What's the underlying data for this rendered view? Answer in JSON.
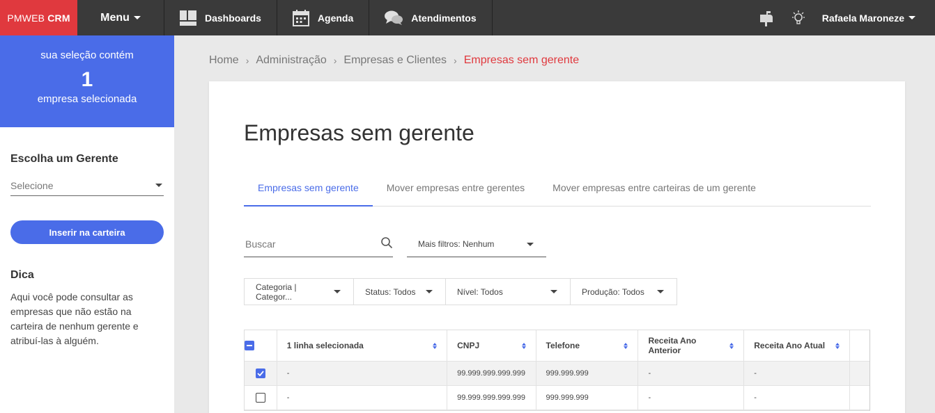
{
  "brand": {
    "name": "PMWEB",
    "product": "CRM"
  },
  "topnav": {
    "menu_label": "Menu",
    "items": [
      {
        "label": "Dashboards",
        "icon": "dashboard-icon"
      },
      {
        "label": "Agenda",
        "icon": "calendar-icon"
      },
      {
        "label": "Atendimentos",
        "icon": "chat-icon"
      }
    ],
    "user_name": "Rafaela Maroneze"
  },
  "sidebar": {
    "selection_line1": "sua seleção contém",
    "selection_count": "1",
    "selection_line2": "empresa selecionada",
    "manager_title": "Escolha um Gerente",
    "manager_select_placeholder": "Selecione",
    "insert_button": "Inserir na carteira",
    "tip_title": "Dica",
    "tip_text": "Aqui você pode consultar as empresas que não estão na carteira de nenhum gerente e atribuí-las à alguém."
  },
  "breadcrumb": {
    "items": [
      "Home",
      "Administração",
      "Empresas e Clientes"
    ],
    "current": "Empresas sem gerente"
  },
  "page": {
    "title": "Empresas sem gerente",
    "tabs": [
      "Empresas sem gerente",
      "Mover empresas entre gerentes",
      "Mover empresas entre carteiras de um gerente"
    ],
    "active_tab": 0,
    "search_placeholder": "Buscar",
    "more_filters": "Mais filtros: Nenhum",
    "filters": [
      "Categoria | Categor...",
      "Status: Todos",
      "Nível: Todos",
      "Produção: Todos"
    ]
  },
  "table": {
    "columns": [
      "1 linha selecionada",
      "CNPJ",
      "Telefone",
      "Receita Ano Anterior",
      "Receita Ano Atual"
    ],
    "rows": [
      {
        "checked": true,
        "name": "-",
        "cnpj": "99.999.999.999.999",
        "telefone": "999.999.999",
        "receita_anterior": "-",
        "receita_atual": "-"
      },
      {
        "checked": false,
        "name": "-",
        "cnpj": "99.999.999.999.999",
        "telefone": "999.999.999",
        "receita_anterior": "-",
        "receita_atual": "-"
      }
    ]
  },
  "colors": {
    "brand_red": "#e0393e",
    "accent_blue": "#4a6ce8",
    "topbar": "#3a3a3a"
  }
}
